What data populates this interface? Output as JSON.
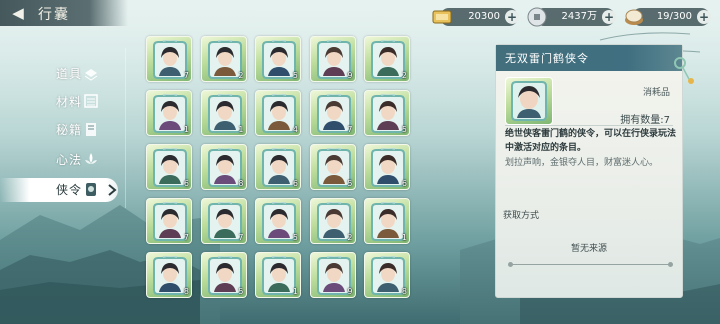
{
  "topbar": {
    "title": "行囊",
    "resources": [
      {
        "name": "ticket",
        "icon": "ticket-icon",
        "value": "20300"
      },
      {
        "name": "silver",
        "icon": "silver-coin-icon",
        "value": "2437万"
      },
      {
        "name": "food",
        "icon": "bun-icon",
        "value": "19/300"
      }
    ]
  },
  "sidebar": {
    "items": [
      {
        "label": "道具",
        "icon": "items-icon",
        "active": false
      },
      {
        "label": "材料",
        "icon": "materials-icon",
        "active": false
      },
      {
        "label": "秘籍",
        "icon": "manual-icon",
        "active": false
      },
      {
        "label": "心法",
        "icon": "lotus-icon",
        "active": false
      },
      {
        "label": "侠令",
        "icon": "token-icon",
        "active": true
      }
    ]
  },
  "tokens": {
    "counts": [
      "7",
      "2",
      "5",
      "9",
      "2",
      "1",
      "1",
      "4",
      "7",
      "5",
      "6",
      "8",
      "6",
      "5",
      "6",
      "7",
      "7",
      "5",
      "2",
      "1",
      "8",
      "5",
      "1",
      "9",
      "8"
    ],
    "selected_index": 0
  },
  "detail": {
    "title": "无双雷门鹤侠令",
    "type": "消耗品",
    "own_label": "拥有数量:",
    "own_value": "7",
    "description": "绝世侠客雷门鹤的侠令，可以在行侠录玩法中激活对应的条目。",
    "flavor": "划拉声响，金银夺人目，财富迷人心。",
    "source_label": "获取方式",
    "source_value": "暂无来源"
  },
  "colors": {
    "panel_header": "#436f7d",
    "card_green": "#bddd9c",
    "frame": "#7ec1bb"
  }
}
